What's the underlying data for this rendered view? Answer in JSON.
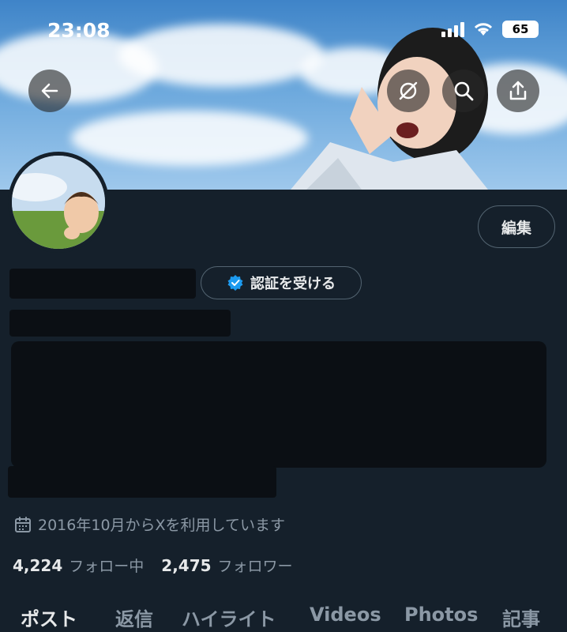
{
  "status_bar": {
    "time": "23:08",
    "battery": "65"
  },
  "header": {
    "back_icon": "arrow-left-icon",
    "translate_icon": "globe-off-icon",
    "search_icon": "search-icon",
    "share_icon": "share-icon"
  },
  "profile": {
    "edit_label": "編集",
    "verify_label": "認証を受ける",
    "joined_text": "2016年10月からXを利用しています",
    "following_count": "4,224",
    "following_label": "フォロー中",
    "followers_count": "2,475",
    "followers_label": "フォロワー"
  },
  "tabs": [
    {
      "label": "ポスト",
      "active": true
    },
    {
      "label": "返信"
    },
    {
      "label": "ハイライト"
    },
    {
      "label": "Videos"
    },
    {
      "label": "Photos"
    },
    {
      "label": "記事"
    }
  ],
  "colors": {
    "background": "#15202b",
    "accent": "#1d9bf0",
    "muted_text": "#8b98a5",
    "border": "#536471"
  }
}
